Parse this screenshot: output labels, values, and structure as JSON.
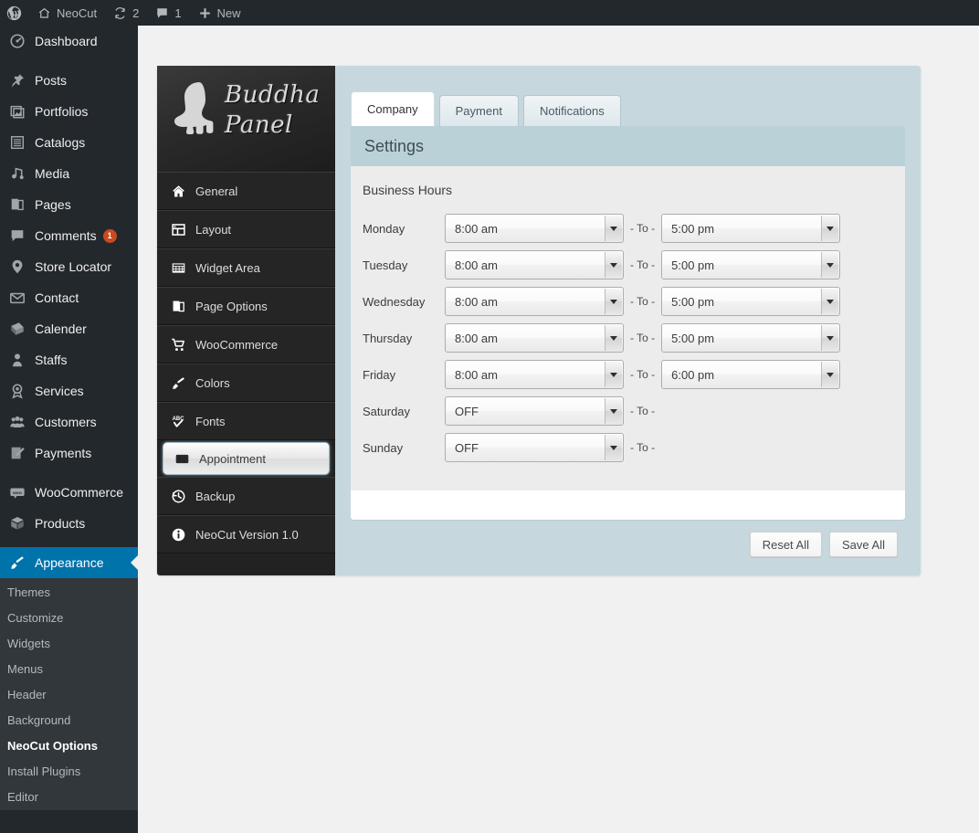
{
  "adminbar": {
    "logo_icon": "wordpress-logo-icon",
    "site_name": "NeoCut",
    "site_icon": "home-icon",
    "updates_icon": "updates-icon",
    "updates_count": "2",
    "comments_icon": "comment-bubble-icon",
    "comments_count": "1",
    "new_icon": "plus-icon",
    "new_label": "New"
  },
  "adminmenu": {
    "items": [
      {
        "label": "Dashboard",
        "icon": "dashboard-icon",
        "badge": null,
        "current": false,
        "sep_before": false
      },
      {
        "label": "Posts",
        "icon": "pin-icon",
        "badge": null,
        "current": false,
        "sep_before": true
      },
      {
        "label": "Portfolios",
        "icon": "portfolio-icon",
        "badge": null,
        "current": false,
        "sep_before": false
      },
      {
        "label": "Catalogs",
        "icon": "list-icon",
        "badge": null,
        "current": false,
        "sep_before": false
      },
      {
        "label": "Media",
        "icon": "media-icon",
        "badge": null,
        "current": false,
        "sep_before": false
      },
      {
        "label": "Pages",
        "icon": "pages-icon",
        "badge": null,
        "current": false,
        "sep_before": false
      },
      {
        "label": "Comments",
        "icon": "comment-bubble-icon",
        "badge": "1",
        "current": false,
        "sep_before": false
      },
      {
        "label": "Store Locator",
        "icon": "map-marker-icon",
        "badge": null,
        "current": false,
        "sep_before": false
      },
      {
        "label": "Contact",
        "icon": "envelope-icon",
        "badge": null,
        "current": false,
        "sep_before": false
      },
      {
        "label": "Calender",
        "icon": "calendar-icon",
        "badge": null,
        "current": false,
        "sep_before": false
      },
      {
        "label": "Staffs",
        "icon": "user-icon",
        "badge": null,
        "current": false,
        "sep_before": false
      },
      {
        "label": "Services",
        "icon": "award-icon",
        "badge": null,
        "current": false,
        "sep_before": false
      },
      {
        "label": "Customers",
        "icon": "group-icon",
        "badge": null,
        "current": false,
        "sep_before": false
      },
      {
        "label": "Payments",
        "icon": "edit-page-icon",
        "badge": null,
        "current": false,
        "sep_before": false
      },
      {
        "label": "WooCommerce",
        "icon": "woo-icon",
        "badge": null,
        "current": false,
        "sep_before": true
      },
      {
        "label": "Products",
        "icon": "box-icon",
        "badge": null,
        "current": false,
        "sep_before": false
      },
      {
        "label": "Appearance",
        "icon": "brush-icon",
        "badge": null,
        "current": true,
        "sep_before": true
      }
    ],
    "submenu": [
      {
        "label": "Themes",
        "current": false
      },
      {
        "label": "Customize",
        "current": false
      },
      {
        "label": "Widgets",
        "current": false
      },
      {
        "label": "Menus",
        "current": false
      },
      {
        "label": "Header",
        "current": false
      },
      {
        "label": "Background",
        "current": false
      },
      {
        "label": "NeoCut Options",
        "current": true
      },
      {
        "label": "Install Plugins",
        "current": false
      },
      {
        "label": "Editor",
        "current": false
      }
    ]
  },
  "panel": {
    "logo_line1": "Buddha",
    "logo_line2": "Panel",
    "logo_icon": "buddha-face-icon",
    "nav": [
      {
        "label": "General",
        "icon": "home-icon",
        "active": false
      },
      {
        "label": "Layout",
        "icon": "layout-icon",
        "active": false
      },
      {
        "label": "Widget Area",
        "icon": "widget-grid-icon",
        "active": false
      },
      {
        "label": "Page Options",
        "icon": "pages-icon",
        "active": false
      },
      {
        "label": "WooCommerce",
        "icon": "cart-icon",
        "active": false
      },
      {
        "label": "Colors",
        "icon": "brush-icon",
        "active": false
      },
      {
        "label": "Fonts",
        "icon": "abc-check-icon",
        "active": false
      },
      {
        "label": "Appointment",
        "icon": "id-card-icon",
        "active": true
      },
      {
        "label": "Backup",
        "icon": "clock-restore-icon",
        "active": false
      },
      {
        "label": "NeoCut Version 1.0",
        "icon": "info-icon",
        "active": false
      }
    ],
    "tabs": [
      {
        "label": "Company",
        "active": true
      },
      {
        "label": "Payment",
        "active": false
      },
      {
        "label": "Notifications",
        "active": false
      }
    ],
    "header_title": "Settings",
    "section_title": "Business Hours",
    "to_label": "- To -",
    "hours": [
      {
        "day": "Monday",
        "open": "8:00 am",
        "close": "5:00 pm",
        "closed": false
      },
      {
        "day": "Tuesday",
        "open": "8:00 am",
        "close": "5:00 pm",
        "closed": false
      },
      {
        "day": "Wednesday",
        "open": "8:00 am",
        "close": "5:00 pm",
        "closed": false
      },
      {
        "day": "Thursday",
        "open": "8:00 am",
        "close": "5:00 pm",
        "closed": false
      },
      {
        "day": "Friday",
        "open": "8:00 am",
        "close": "6:00 pm",
        "closed": false
      },
      {
        "day": "Saturday",
        "open": "OFF",
        "close": "",
        "closed": true
      },
      {
        "day": "Sunday",
        "open": "OFF",
        "close": "",
        "closed": true
      }
    ],
    "footer": {
      "reset_label": "Reset All",
      "save_label": "Save All"
    }
  },
  "colors": {
    "admin_dark": "#23282d",
    "admin_submenu": "#32373c",
    "accent_blue": "#0073aa",
    "badge_orange": "#ca4a1f",
    "panel_container": "#c6d8dd",
    "panel_header": "#bbd1d8",
    "panel_body": "#ececec",
    "page_bg": "#f1f1f1"
  }
}
